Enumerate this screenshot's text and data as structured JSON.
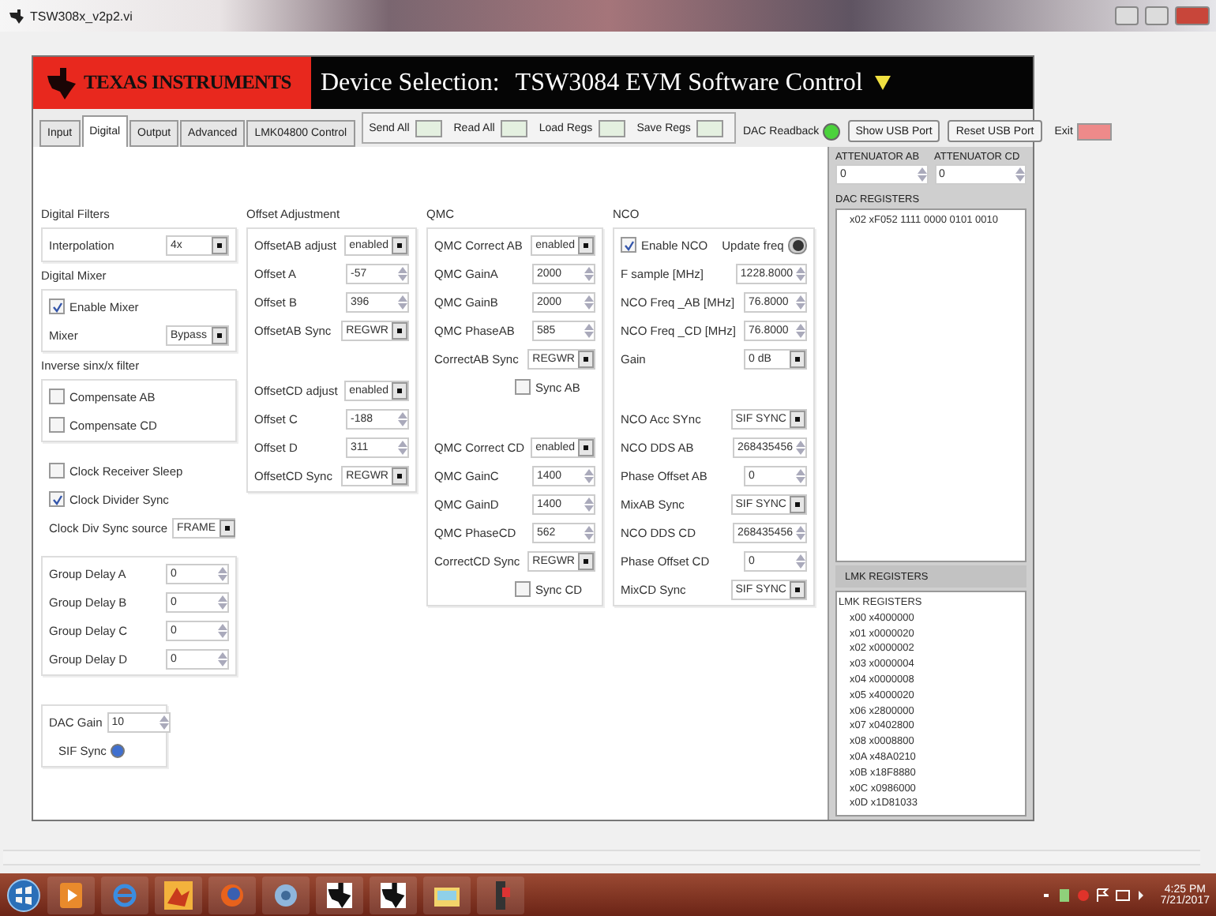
{
  "window": {
    "title": "TSW308x_v2p2.vi"
  },
  "header": {
    "brand": "TEXAS INSTRUMENTS",
    "label": "Device Selection:",
    "device": "TSW3084 EVM Software Control"
  },
  "tabs": [
    {
      "label": "Input",
      "selected": false
    },
    {
      "label": "Digital",
      "selected": true
    },
    {
      "label": "Output",
      "selected": false
    },
    {
      "label": "Advanced",
      "selected": false
    },
    {
      "label": "LMK04800 Control",
      "selected": false
    }
  ],
  "toolbar": {
    "actions": [
      {
        "label": "Send All"
      },
      {
        "label": "Read All"
      },
      {
        "label": "Load Regs"
      },
      {
        "label": "Save Regs"
      }
    ],
    "readback": {
      "label": "DAC Readback",
      "on": true
    },
    "buttons": [
      "Show USB Port",
      "Reset USB Port"
    ],
    "exit": "Exit"
  },
  "columns": [
    {
      "groups": [
        {
          "title": "Digital Filters",
          "framed": true,
          "blocks": [
            [
              {
                "kind": "select",
                "label": "Interpolation",
                "value": "4x"
              }
            ]
          ]
        },
        {
          "title": "Digital Mixer",
          "framed": true,
          "blocks": [
            [
              {
                "kind": "check",
                "label": "Enable Mixer",
                "checked": true
              },
              {
                "kind": "select",
                "label": "Mixer",
                "value": "Bypass"
              }
            ]
          ]
        },
        {
          "title": "Inverse sinx/x filter",
          "framed": true,
          "blocks": [
            [
              {
                "kind": "check",
                "label": "Compensate AB",
                "checked": false
              },
              {
                "kind": "check",
                "label": "Compensate CD",
                "checked": false
              }
            ]
          ]
        },
        {
          "framed": false,
          "blocks": [
            [
              {
                "kind": "check",
                "label": "Clock Receiver Sleep",
                "checked": false
              },
              {
                "kind": "check",
                "label": "Clock Divider Sync",
                "checked": true
              },
              {
                "kind": "select",
                "label": "Clock Div Sync source",
                "value": "FRAME"
              }
            ]
          ]
        },
        {
          "framed": true,
          "blocks": [
            [
              {
                "kind": "spin",
                "label": "Group Delay A",
                "value": "0"
              },
              {
                "kind": "spin",
                "label": "Group Delay B",
                "value": "0"
              },
              {
                "kind": "spin",
                "label": "Group Delay C",
                "value": "0"
              },
              {
                "kind": "spin",
                "label": "Group Delay D",
                "value": "0"
              }
            ]
          ]
        },
        {
          "framed": true,
          "blocks": [
            [
              {
                "kind": "spin",
                "label": "DAC Gain",
                "value": "10"
              },
              {
                "kind": "led",
                "label": "SIF Sync",
                "on": true
              }
            ]
          ]
        }
      ]
    },
    {
      "groups": [
        {
          "title": "Offset Adjustment",
          "framed": true,
          "blocks": [
            [
              {
                "kind": "select",
                "label": "OffsetAB adjust",
                "value": "enabled"
              },
              {
                "kind": "spin",
                "label": "Offset A",
                "value": "-57"
              },
              {
                "kind": "spin",
                "label": "Offset B",
                "value": "396"
              },
              {
                "kind": "select",
                "label": "OffsetAB Sync",
                "value": "REGWR"
              }
            ],
            [
              {
                "kind": "select",
                "label": "OffsetCD adjust",
                "value": "enabled"
              },
              {
                "kind": "spin",
                "label": "Offset C",
                "value": "-188"
              },
              {
                "kind": "spin",
                "label": "Offset D",
                "value": "311"
              },
              {
                "kind": "select",
                "label": "OffsetCD Sync",
                "value": "REGWR"
              }
            ]
          ]
        }
      ]
    },
    {
      "groups": [
        {
          "title": "QMC",
          "framed": true,
          "blocks": [
            [
              {
                "kind": "select",
                "label": "QMC Correct AB",
                "value": "enabled"
              },
              {
                "kind": "spin",
                "label": "QMC GainA",
                "value": "2000"
              },
              {
                "kind": "spin",
                "label": "QMC GainB",
                "value": "2000"
              },
              {
                "kind": "spin",
                "label": "QMC PhaseAB",
                "value": "585"
              },
              {
                "kind": "select",
                "label": "CorrectAB Sync",
                "value": "REGWR"
              },
              {
                "kind": "subcheck",
                "label": "Sync AB",
                "checked": false
              }
            ],
            [
              {
                "kind": "select",
                "label": "QMC Correct CD",
                "value": "enabled"
              },
              {
                "kind": "spin",
                "label": "QMC GainC",
                "value": "1400"
              },
              {
                "kind": "spin",
                "label": "QMC GainD",
                "value": "1400"
              },
              {
                "kind": "spin",
                "label": "QMC PhaseCD",
                "value": "562"
              },
              {
                "kind": "select",
                "label": "CorrectCD Sync",
                "value": "REGWR"
              },
              {
                "kind": "subcheck",
                "label": "Sync CD",
                "checked": false
              }
            ]
          ]
        }
      ]
    },
    {
      "groups": [
        {
          "title": "NCO",
          "framed": true,
          "blocks": [
            [
              {
                "kind": "checktoggle",
                "label": "Enable NCO",
                "checked": true,
                "toggle_label": "Update freq",
                "on": true
              },
              {
                "kind": "spin",
                "label": "F sample [MHz]",
                "value": "1228.8000"
              },
              {
                "kind": "spin",
                "label": "NCO Freq _AB [MHz]",
                "value": "76.8000"
              },
              {
                "kind": "spin",
                "label": "NCO Freq _CD [MHz]",
                "value": "76.8000"
              },
              {
                "kind": "select",
                "label": "Gain",
                "value": "0 dB"
              }
            ],
            [
              {
                "kind": "select",
                "label": "NCO Acc SYnc",
                "value": "SIF SYNC"
              },
              {
                "kind": "spin",
                "label": "NCO DDS AB",
                "value": "268435456"
              },
              {
                "kind": "spin",
                "label": "Phase Offset AB",
                "value": "0"
              },
              {
                "kind": "select",
                "label": "MixAB Sync",
                "value": "SIF SYNC"
              },
              {
                "kind": "spin",
                "label": "NCO DDS CD",
                "value": "268435456"
              },
              {
                "kind": "spin",
                "label": "Phase Offset CD",
                "value": "0"
              },
              {
                "kind": "select",
                "label": "MixCD Sync",
                "value": "SIF SYNC"
              }
            ]
          ]
        }
      ]
    }
  ],
  "side": {
    "attenuators": [
      {
        "label": "ATTENUATOR AB",
        "value": "0"
      },
      {
        "label": "ATTENUATOR CD",
        "value": "0"
      }
    ],
    "dac_registers": {
      "title": "DAC REGISTERS",
      "lines": [
        "x02 xF052 1111 0000 0101 0010"
      ]
    },
    "lmk_registers": {
      "title": "LMK REGISTERS",
      "heading": "LMK REGISTERS",
      "lines": [
        "x00 x4000000",
        "x01 x0000020",
        "x02 x0000002",
        "x03 x0000004",
        "x04 x0000008",
        "x05 x4000020",
        "x06 x2800000",
        "x07 x0402800",
        "x08 x0008800",
        "x0A x48A0210",
        "x0B x18F8880",
        "x0C x0986000",
        "x0D x1D81033"
      ]
    }
  },
  "clock": {
    "time": "4:25 PM",
    "date": "7/21/2017"
  }
}
